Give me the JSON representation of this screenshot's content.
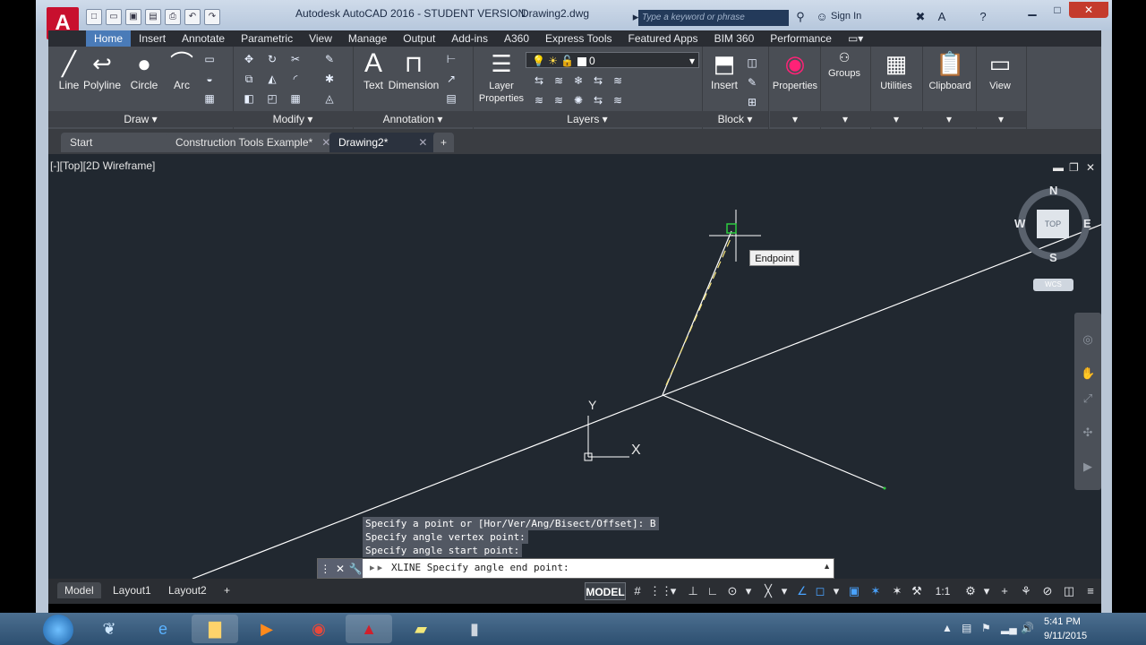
{
  "titlebar": {
    "app_logo": "A",
    "title": "Autodesk AutoCAD 2016 - STUDENT VERSION",
    "document": "Drawing2.dwg",
    "search_placeholder": "Type a keyword or phrase",
    "sign_in": "Sign In",
    "qat_icons": [
      "new-icon",
      "open-icon",
      "save-icon",
      "save-as-icon",
      "print-icon",
      "undo-icon",
      "redo-icon"
    ]
  },
  "ribbon": {
    "tabs": [
      "Home",
      "Insert",
      "Annotate",
      "Parametric",
      "View",
      "Manage",
      "Output",
      "Add-ins",
      "A360",
      "Express Tools",
      "Featured Apps",
      "BIM 360",
      "Performance"
    ],
    "active_tab": "Home",
    "draw": {
      "title": "Draw",
      "line": "Line",
      "polyline": "Polyline",
      "circle": "Circle",
      "arc": "Arc"
    },
    "modify": {
      "title": "Modify"
    },
    "annotation": {
      "title": "Annotation",
      "text": "Text",
      "dimension": "Dimension"
    },
    "layers": {
      "title": "Layers",
      "layer_properties": "Layer Properties",
      "current_layer": "0"
    },
    "block": {
      "title": "Block",
      "insert": "Insert"
    },
    "properties": "Properties",
    "groups": "Groups",
    "utilities": "Utilities",
    "clipboard": "Clipboard",
    "view": "View"
  },
  "doc_tabs": [
    {
      "label": "Start",
      "closable": false
    },
    {
      "label": "Construction Tools Example*",
      "closable": true
    },
    {
      "label": "Drawing2*",
      "closable": true,
      "active": true
    }
  ],
  "viewport": {
    "label": "[-][Top][2D Wireframe]",
    "compass": {
      "n": "N",
      "s": "S",
      "e": "E",
      "w": "W",
      "cube_face": "TOP"
    },
    "wcs": "WCS",
    "tooltip": "Endpoint",
    "ucs_x": "X",
    "ucs_y": "Y"
  },
  "command": {
    "history": [
      "Specify a point or [Hor/Ver/Ang/Bisect/Offset]: B",
      "Specify angle vertex point:",
      "Specify angle start point:"
    ],
    "prompt": "XLINE Specify angle end point:"
  },
  "layout_tabs": [
    "Model",
    "Layout1",
    "Layout2"
  ],
  "statusbar": {
    "model": "MODEL",
    "scale": "1:1"
  },
  "taskbar": {
    "time": "5:41 PM",
    "date": "9/11/2015"
  },
  "colors": {
    "canvas": "#212830",
    "ribbon": "#4a4e55",
    "accent": "#4a7bb8",
    "construction": "#f4e27a",
    "osnap": "#2ecc40"
  }
}
